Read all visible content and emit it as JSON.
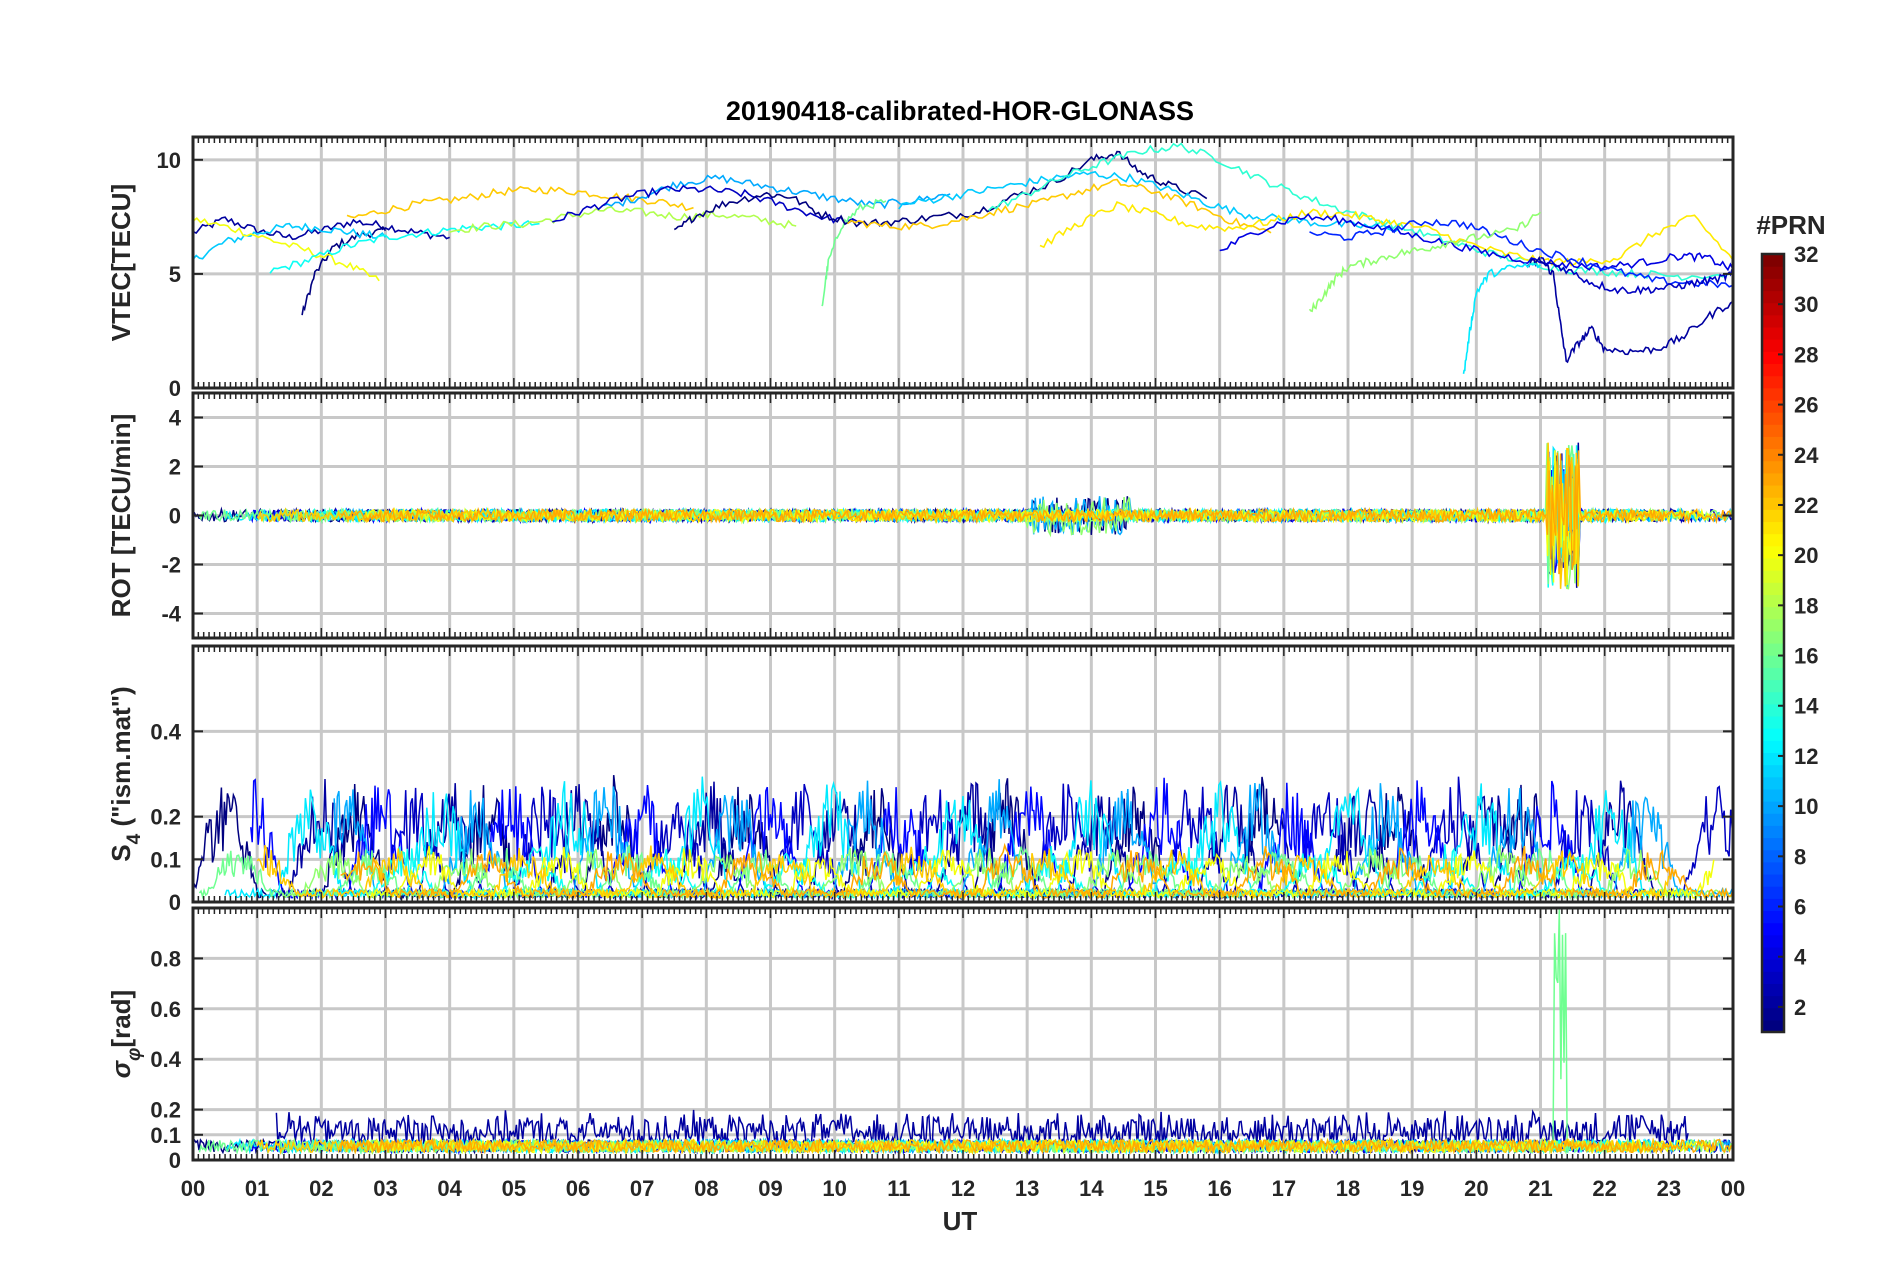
{
  "chart_data": {
    "type": "line",
    "title": "20190418-calibrated-HOR-GLONASS",
    "xlabel": "UT",
    "x_tick_labels": [
      "00",
      "01",
      "02",
      "03",
      "04",
      "05",
      "06",
      "07",
      "08",
      "09",
      "10",
      "11",
      "12",
      "13",
      "14",
      "15",
      "16",
      "17",
      "18",
      "19",
      "20",
      "21",
      "22",
      "23",
      "00"
    ],
    "xlim": [
      0,
      24
    ],
    "grid": true,
    "colorbar": {
      "title": "#PRN",
      "tick_labels": [
        "2",
        "4",
        "6",
        "8",
        "10",
        "12",
        "14",
        "16",
        "18",
        "20",
        "22",
        "24",
        "26",
        "28",
        "30",
        "32"
      ],
      "range": [
        1,
        32
      ],
      "colormap": "jet"
    },
    "panels": [
      {
        "ylabel": "VTEC[TECU]",
        "ylim": [
          0,
          11
        ],
        "yticks": [
          0,
          5,
          10
        ],
        "ytick_labels": [
          "0",
          "5",
          "10"
        ],
        "series": [
          {
            "prn": 2,
            "x": [
              0.0,
              0.5,
              1.0,
              1.5,
              2.0,
              2.5,
              3.0,
              3.5,
              4.0
            ],
            "y": [
              6.8,
              7.4,
              6.9,
              6.6,
              6.9,
              7.3,
              7.1,
              6.8,
              6.6
            ]
          },
          {
            "prn": 1,
            "x": [
              1.7,
              1.9,
              2.2,
              2.6,
              3.0
            ],
            "y": [
              3.2,
              5.0,
              6.2,
              6.7,
              6.9
            ]
          },
          {
            "prn": 11,
            "x": [
              0.0,
              0.5,
              1.0,
              1.5,
              2.0,
              2.5,
              3.0
            ],
            "y": [
              5.6,
              6.4,
              6.8,
              7.1,
              7.0,
              6.8,
              6.6
            ]
          },
          {
            "prn": 20,
            "x": [
              0.0,
              0.6,
              1.2,
              1.8,
              2.4,
              2.9
            ],
            "y": [
              7.4,
              7.0,
              6.5,
              6.0,
              5.4,
              4.7
            ]
          },
          {
            "prn": 13,
            "x": [
              1.2,
              1.8,
              2.4,
              3.0,
              3.6,
              4.2,
              4.8,
              5.4
            ],
            "y": [
              5.1,
              5.6,
              6.2,
              6.6,
              6.8,
              7.0,
              7.1,
              7.2
            ]
          },
          {
            "prn": 22,
            "x": [
              2.4,
              3.0,
              3.6,
              4.2,
              4.8,
              5.4,
              6.0,
              6.6,
              7.2,
              7.8
            ],
            "y": [
              7.4,
              7.8,
              8.1,
              8.3,
              8.6,
              8.7,
              8.6,
              8.4,
              8.2,
              7.9
            ]
          },
          {
            "prn": 18,
            "x": [
              4.0,
              4.6,
              5.2,
              5.8,
              6.4,
              7.0,
              7.6,
              8.2,
              8.8,
              9.4
            ],
            "y": [
              6.9,
              7.1,
              7.2,
              7.5,
              7.8,
              7.7,
              7.5,
              7.6,
              7.4,
              7.1
            ]
          },
          {
            "prn": 10,
            "x": [
              6.4,
              7.0,
              7.6,
              8.2,
              8.8,
              9.4,
              10.0,
              10.6,
              11.2,
              11.8
            ],
            "y": [
              7.9,
              8.4,
              9.0,
              9.2,
              8.9,
              8.6,
              8.3,
              8.0,
              8.2,
              8.5
            ]
          },
          {
            "prn": 3,
            "x": [
              5.6,
              6.2,
              6.8,
              7.4,
              8.0,
              8.6,
              9.2,
              9.8,
              10.4
            ],
            "y": [
              7.3,
              7.9,
              8.4,
              8.7,
              8.7,
              8.5,
              8.0,
              7.5,
              7.2
            ]
          },
          {
            "prn": 16,
            "x": [
              9.8,
              9.9,
              10.1,
              10.4,
              10.8
            ],
            "y": [
              3.5,
              5.5,
              7.1,
              7.9,
              8.2
            ]
          },
          {
            "prn": 1,
            "x": [
              7.5,
              7.8,
              8.3,
              8.9,
              9.3,
              9.8,
              10.4,
              11.0,
              11.6,
              12.2,
              12.8,
              13.4,
              14.0,
              14.4,
              14.8,
              15.2,
              15.8
            ],
            "y": [
              6.8,
              7.5,
              8.1,
              8.5,
              8.4,
              7.6,
              7.2,
              7.3,
              7.5,
              7.7,
              8.4,
              9.0,
              10.0,
              10.3,
              9.4,
              8.9,
              8.3
            ]
          },
          {
            "prn": 22,
            "x": [
              10.2,
              10.8,
              11.4,
              12.0,
              12.6,
              13.2,
              13.8,
              14.4,
              15.0,
              15.6,
              16.2,
              16.8
            ],
            "y": [
              7.3,
              7.1,
              7.1,
              7.4,
              7.8,
              8.1,
              8.6,
              9.0,
              8.6,
              8.0,
              7.3,
              6.8
            ]
          },
          {
            "prn": 11,
            "x": [
              11.0,
              11.6,
              12.2,
              12.8,
              13.4,
              14.0,
              14.6,
              15.2,
              15.8,
              16.4,
              17.0,
              17.6,
              18.2,
              18.8
            ],
            "y": [
              8.0,
              8.3,
              8.6,
              8.9,
              9.2,
              9.4,
              9.2,
              8.7,
              8.1,
              7.6,
              7.4,
              7.2,
              7.1,
              7.0
            ]
          },
          {
            "prn": 14,
            "x": [
              12.4,
              13.0,
              13.6,
              14.2,
              14.8,
              15.4,
              16.0,
              16.6,
              17.2,
              17.8,
              18.4,
              19.0,
              19.6,
              20.2,
              20.8,
              21.4,
              22.0,
              22.6,
              23.2,
              24.0
            ],
            "y": [
              7.8,
              8.5,
              9.3,
              9.9,
              10.4,
              10.6,
              10.0,
              9.2,
              8.5,
              7.9,
              7.4,
              6.9,
              6.4,
              5.9,
              5.5,
              5.2,
              5.1,
              5.0,
              4.9,
              5.0
            ]
          },
          {
            "prn": 21,
            "x": [
              13.2,
              13.8,
              14.4,
              15.0,
              15.6,
              16.2,
              16.8,
              17.4,
              18.0,
              18.6,
              19.2,
              19.8,
              20.4,
              21.0,
              21.6,
              22.2,
              22.8,
              23.4,
              24.0
            ],
            "y": [
              6.2,
              7.2,
              8.0,
              7.6,
              7.1,
              7.0,
              7.3,
              7.7,
              7.6,
              7.3,
              7.0,
              6.4,
              5.9,
              5.6,
              5.5,
              5.7,
              6.8,
              7.5,
              5.6
            ]
          },
          {
            "prn": 4,
            "x": [
              16.0,
              16.6,
              17.2,
              17.8,
              18.4,
              19.0,
              19.6,
              20.2,
              20.8,
              21.4,
              22.0,
              22.6,
              23.2,
              23.6,
              24.0
            ],
            "y": [
              6.0,
              6.9,
              7.5,
              7.4,
              7.1,
              6.7,
              6.3,
              5.9,
              5.6,
              5.4,
              5.3,
              5.5,
              5.8,
              5.7,
              5.2
            ]
          },
          {
            "prn": 6,
            "x": [
              17.4,
              18.0,
              18.6,
              19.2,
              19.8,
              20.4,
              21.0,
              21.6,
              22.2,
              22.8,
              23.4,
              24.0
            ],
            "y": [
              6.8,
              6.6,
              6.9,
              7.3,
              7.2,
              6.6,
              6.0,
              5.6,
              5.1,
              4.7,
              4.6,
              4.5
            ]
          },
          {
            "prn": 17,
            "x": [
              17.4,
              17.6,
              17.8,
              18.0,
              18.4,
              18.8,
              19.2,
              19.6,
              20.0,
              20.6,
              21.0
            ],
            "y": [
              3.3,
              4.0,
              4.8,
              5.3,
              5.6,
              5.9,
              6.1,
              6.4,
              6.6,
              6.9,
              7.7
            ]
          },
          {
            "prn": 2,
            "x": [
              20.8,
              21.0,
              21.2,
              21.3,
              21.4,
              21.6,
              21.8,
              22.0,
              22.4,
              22.8,
              23.2,
              23.6,
              24.0
            ],
            "y": [
              5.4,
              5.6,
              5.0,
              3.0,
              1.2,
              2.0,
              2.6,
              1.7,
              1.6,
              1.7,
              2.2,
              3.1,
              3.8
            ]
          },
          {
            "prn": 12,
            "x": [
              19.8,
              19.9,
              20.0,
              20.2,
              20.6,
              21.0
            ],
            "y": [
              0.5,
              2.5,
              4.2,
              5.0,
              5.3,
              5.4
            ]
          },
          {
            "prn": 3,
            "x": [
              21.0,
              21.4,
              21.8,
              22.2,
              22.6,
              23.0,
              23.4,
              23.8,
              24.0
            ],
            "y": [
              5.6,
              5.2,
              4.6,
              4.3,
              4.3,
              4.4,
              4.6,
              4.8,
              5.0
            ]
          }
        ]
      },
      {
        "ylabel": "ROT [TECU/min]",
        "ylim": [
          -5,
          5
        ],
        "yticks": [
          -4,
          -2,
          0,
          2,
          4
        ],
        "ytick_labels": [
          "-4",
          "-2",
          "0",
          "2",
          "4"
        ]
      },
      {
        "ylabel": "S4 (\"ism.mat\")",
        "ylabel_parts": {
          "main": "S",
          "sub": "4",
          "rest": " (\"ism.mat\")"
        },
        "ylim": [
          0,
          0.6
        ],
        "yticks": [
          0,
          0.1,
          0.2,
          0.4
        ],
        "ytick_labels": [
          "0",
          "0.1",
          "0.2",
          "0.4"
        ]
      },
      {
        "ylabel": "σφ[rad]",
        "ylabel_parts": {
          "main": "σ",
          "sub": "φ",
          "rest": "[rad]"
        },
        "ylim": [
          0,
          1
        ],
        "yticks": [
          0,
          0.1,
          0.2,
          0.4,
          0.6,
          0.8
        ],
        "ytick_labels": [
          "0",
          "0.1",
          "0.2",
          "0.4",
          "0.6",
          "0.8"
        ]
      }
    ]
  }
}
